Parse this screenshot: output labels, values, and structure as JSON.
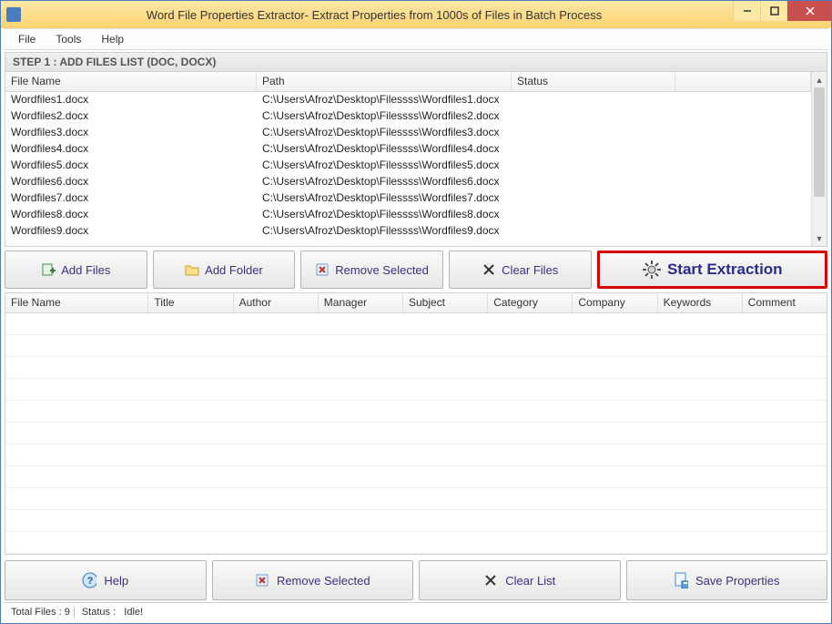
{
  "window": {
    "title": "Word File Properties Extractor- Extract Properties from 1000s of Files in Batch Process"
  },
  "menu": {
    "file": "File",
    "tools": "Tools",
    "help": "Help"
  },
  "step1": {
    "label": "STEP 1 : ADD FILES LIST (DOC, DOCX)",
    "columns": {
      "filename": "File Name",
      "path": "Path",
      "status": "Status"
    },
    "rows": [
      {
        "filename": "Wordfiles1.docx",
        "path": "C:\\Users\\Afroz\\Desktop\\Filessss\\Wordfiles1.docx",
        "status": ""
      },
      {
        "filename": "Wordfiles2.docx",
        "path": "C:\\Users\\Afroz\\Desktop\\Filessss\\Wordfiles2.docx",
        "status": ""
      },
      {
        "filename": "Wordfiles3.docx",
        "path": "C:\\Users\\Afroz\\Desktop\\Filessss\\Wordfiles3.docx",
        "status": ""
      },
      {
        "filename": "Wordfiles4.docx",
        "path": "C:\\Users\\Afroz\\Desktop\\Filessss\\Wordfiles4.docx",
        "status": ""
      },
      {
        "filename": "Wordfiles5.docx",
        "path": "C:\\Users\\Afroz\\Desktop\\Filessss\\Wordfiles5.docx",
        "status": ""
      },
      {
        "filename": "Wordfiles6.docx",
        "path": "C:\\Users\\Afroz\\Desktop\\Filessss\\Wordfiles6.docx",
        "status": ""
      },
      {
        "filename": "Wordfiles7.docx",
        "path": "C:\\Users\\Afroz\\Desktop\\Filessss\\Wordfiles7.docx",
        "status": ""
      },
      {
        "filename": "Wordfiles8.docx",
        "path": "C:\\Users\\Afroz\\Desktop\\Filessss\\Wordfiles8.docx",
        "status": ""
      },
      {
        "filename": "Wordfiles9.docx",
        "path": "C:\\Users\\Afroz\\Desktop\\Filessss\\Wordfiles9.docx",
        "status": ""
      }
    ]
  },
  "actions": {
    "add_files": "Add Files",
    "add_folder": "Add Folder",
    "remove_selected": "Remove Selected",
    "clear_files": "Clear Files",
    "start_extraction": "Start Extraction"
  },
  "props": {
    "columns": {
      "filename": "File Name",
      "title": "Title",
      "author": "Author",
      "manager": "Manager",
      "subject": "Subject",
      "category": "Category",
      "company": "Company",
      "keywords": "Keywords",
      "comment": "Comment"
    }
  },
  "bottom": {
    "help": "Help",
    "remove_selected": "Remove Selected",
    "clear_list": "Clear List",
    "save_properties": "Save Properties"
  },
  "status": {
    "total_files_label": "Total Files :",
    "total_files_value": "9",
    "status_label": "Status :",
    "status_value": "Idle!"
  }
}
